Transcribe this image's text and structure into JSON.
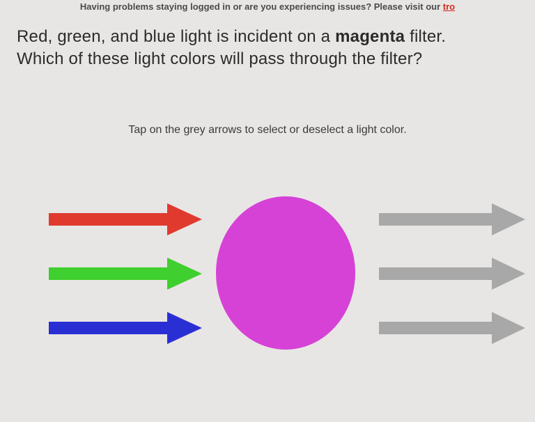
{
  "banner": {
    "prefix": "Having problems staying logged in or are you experiencing issues? Please visit our ",
    "link": "tro"
  },
  "question": {
    "line1_pre": "Red, green, and blue light is incident on a ",
    "line1_bold": "magenta",
    "line1_post": " filter.",
    "line2": "Which of these light colors will pass through the filter?"
  },
  "instruction": "Tap on the grey arrows to select or deselect a light color.",
  "colors": {
    "red": "#e03a2f",
    "green": "#3fcf2e",
    "blue": "#2a2fd4",
    "grey": "#a8a8a8",
    "magenta": "#d642d6"
  },
  "arrows_left": [
    {
      "name": "red",
      "color_key": "red"
    },
    {
      "name": "green",
      "color_key": "green"
    },
    {
      "name": "blue",
      "color_key": "blue"
    }
  ],
  "arrows_right": [
    {
      "name": "output-top",
      "color_key": "grey"
    },
    {
      "name": "output-middle",
      "color_key": "grey"
    },
    {
      "name": "output-bottom",
      "color_key": "grey"
    }
  ]
}
